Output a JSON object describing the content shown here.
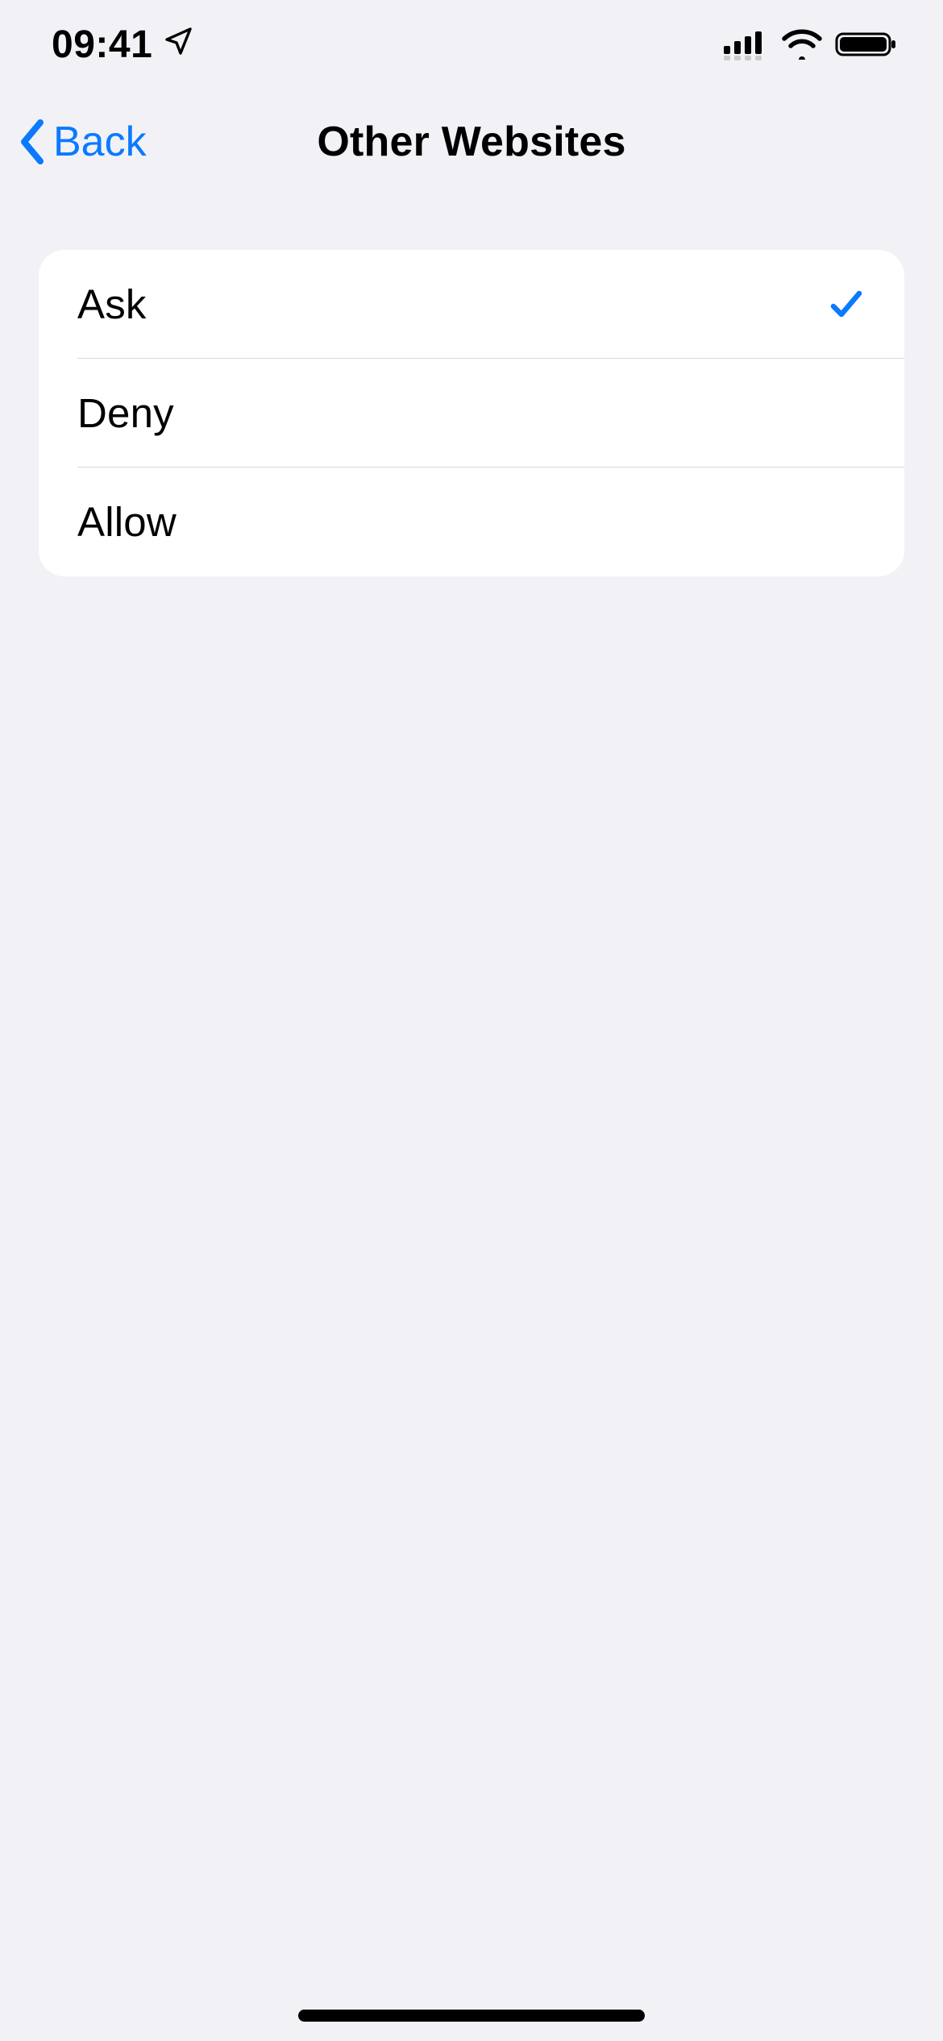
{
  "statusBar": {
    "time": "09:41"
  },
  "nav": {
    "back": "Back",
    "title": "Other Websites"
  },
  "options": {
    "items": [
      {
        "label": "Ask",
        "selected": true
      },
      {
        "label": "Deny",
        "selected": false
      },
      {
        "label": "Allow",
        "selected": false
      }
    ]
  },
  "colors": {
    "accent": "#0a7aff",
    "background": "#f2f1f6",
    "card": "#ffffff",
    "separator": "#d8d7dc"
  }
}
